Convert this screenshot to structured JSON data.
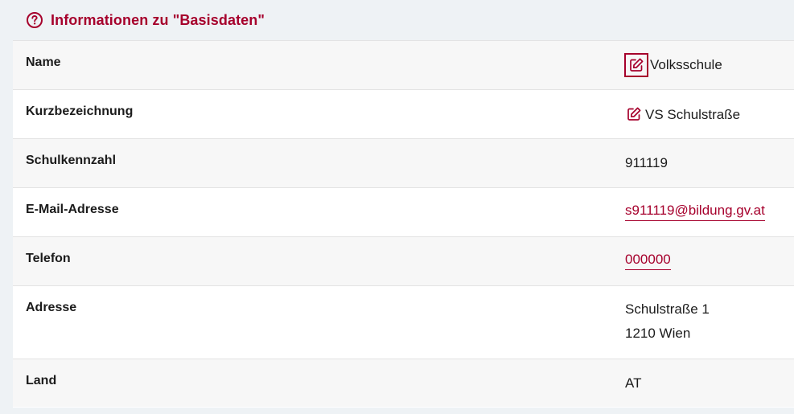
{
  "header": {
    "title": "Informationen zu \"Basisdaten\""
  },
  "colors": {
    "accent": "#a6002c",
    "row_alt": "#f7f7f7",
    "background": "#eef2f5"
  },
  "icons": {
    "help": "question-circle-icon",
    "edit": "edit-pencil-icon"
  },
  "rows": [
    {
      "label": "Name",
      "value": "Volksschule",
      "editable": true
    },
    {
      "label": "Kurzbezeichnung",
      "value": "VS Schulstraße",
      "editable": true
    },
    {
      "label": "Schulkennzahl",
      "value": "911119"
    },
    {
      "label": "E-Mail-Adresse",
      "value": "s911119@bildung.gv.at",
      "link": true
    },
    {
      "label": "Telefon",
      "value": "000000",
      "link": true
    },
    {
      "label": "Adresse",
      "value_lines": [
        "Schulstraße 1",
        "1210 Wien"
      ]
    },
    {
      "label": "Land",
      "value": "AT"
    }
  ]
}
